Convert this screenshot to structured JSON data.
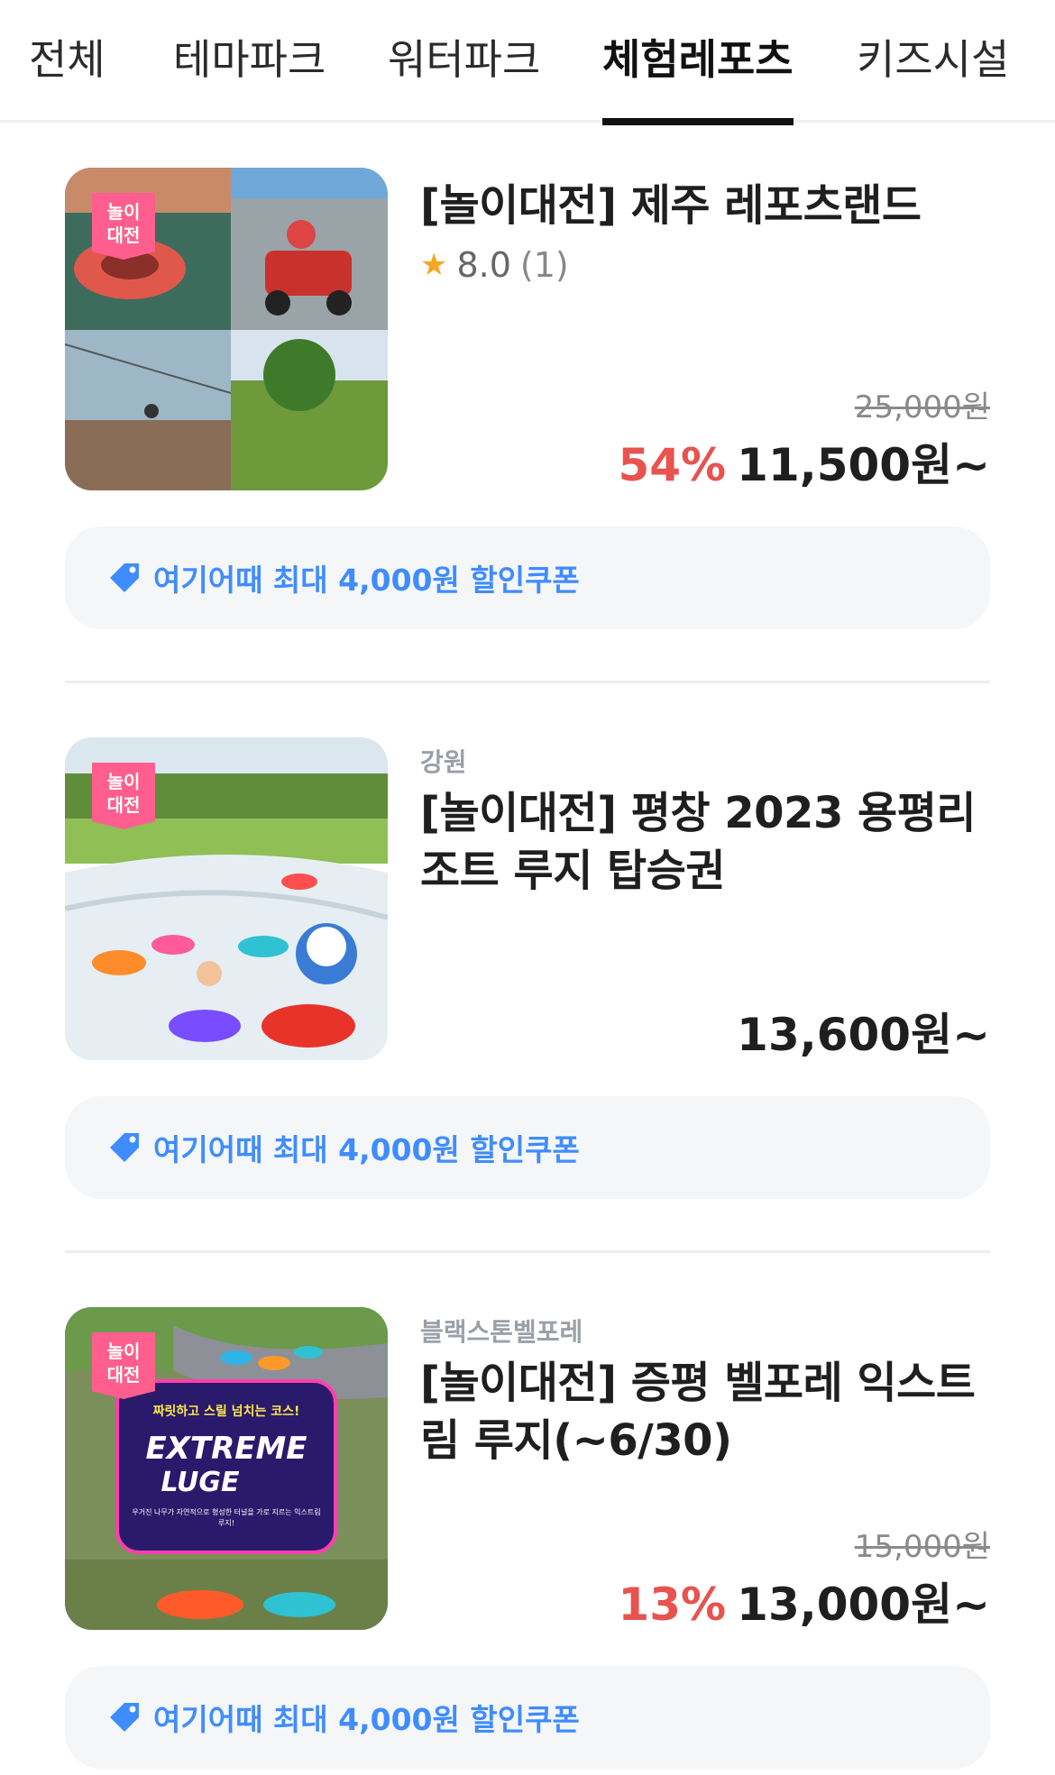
{
  "tabs": [
    {
      "label": "전체",
      "active": false
    },
    {
      "label": "테마파크",
      "active": false
    },
    {
      "label": "워터파크",
      "active": false
    },
    {
      "label": "체험레포츠",
      "active": true
    },
    {
      "label": "키즈시설",
      "active": false
    }
  ],
  "products": [
    {
      "badge": "놀이\n대전",
      "region": "",
      "title": "[놀이대전] 제주 레포츠랜드",
      "rating": "8.0",
      "rating_count": "(1)",
      "original_price": "25,000원",
      "discount": "54%",
      "price": "11,500원~",
      "coupon": "여기어때 최대 4,000원 할인쿠폰"
    },
    {
      "badge": "놀이\n대전",
      "region": "강원",
      "title": "[놀이대전] 평창 2023 용평리조트 루지 탑승권",
      "rating": "",
      "rating_count": "",
      "original_price": "",
      "discount": "",
      "price": "13,600원~",
      "coupon": "여기어때 최대 4,000원 할인쿠폰"
    },
    {
      "badge": "놀이\n대전",
      "region": "블랙스톤벨포레",
      "title": "[놀이대전] 증평 벨포레 익스트림 루지(~6/30)",
      "rating": "",
      "rating_count": "",
      "original_price": "15,000원",
      "discount": "13%",
      "price": "13,000원~",
      "coupon": "여기어때 최대 4,000원 할인쿠폰",
      "image_text": {
        "headline": "짜릿하고 스릴 넘치는 코스!",
        "logo_line1": "EXTREME",
        "logo_line2": "LUGE",
        "caption": "우거진 나무가 자연적으로 형성한 터널을 가로 지르는 익스트림 루지!"
      }
    }
  ],
  "colors": {
    "accent_blue": "#3f8cff",
    "discount_red": "#e8524f",
    "badge_pink": "#ff5e8e",
    "star": "#f5a623"
  }
}
